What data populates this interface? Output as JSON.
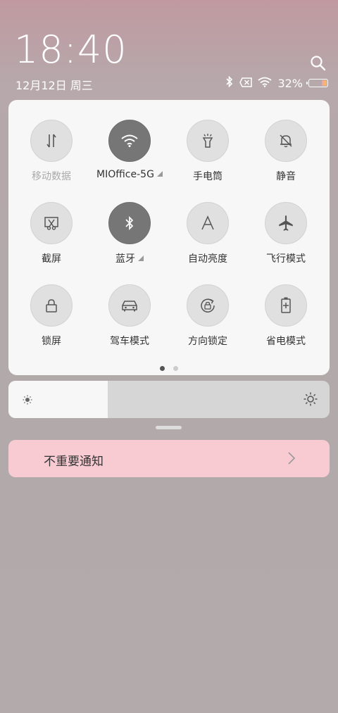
{
  "header": {
    "time": "18:40",
    "date": "12月12日 周三",
    "battery_percent": "32%",
    "battery_level": 0.32
  },
  "tiles": [
    {
      "label": "移动数据",
      "icon": "mobile-data-icon",
      "active": false
    },
    {
      "label": "MIOffice-5G",
      "icon": "wifi-icon",
      "active": true
    },
    {
      "label": "手电筒",
      "icon": "flashlight-icon",
      "active": false
    },
    {
      "label": "静音",
      "icon": "mute-bell-icon",
      "active": false
    },
    {
      "label": "截屏",
      "icon": "screenshot-icon",
      "active": false
    },
    {
      "label": "蓝牙",
      "icon": "bluetooth-icon",
      "active": true
    },
    {
      "label": "自动亮度",
      "icon": "auto-brightness-icon",
      "active": false
    },
    {
      "label": "飞行模式",
      "icon": "airplane-icon",
      "active": false
    },
    {
      "label": "锁屏",
      "icon": "lock-icon",
      "active": false
    },
    {
      "label": "驾车模式",
      "icon": "car-icon",
      "active": false
    },
    {
      "label": "方向锁定",
      "icon": "rotation-lock-icon",
      "active": false
    },
    {
      "label": "省电模式",
      "icon": "battery-saver-icon",
      "active": false
    }
  ],
  "pager": {
    "pages": 2,
    "current": 1
  },
  "brightness": {
    "level": 0.31
  },
  "notification": {
    "label": "不重要通知"
  }
}
